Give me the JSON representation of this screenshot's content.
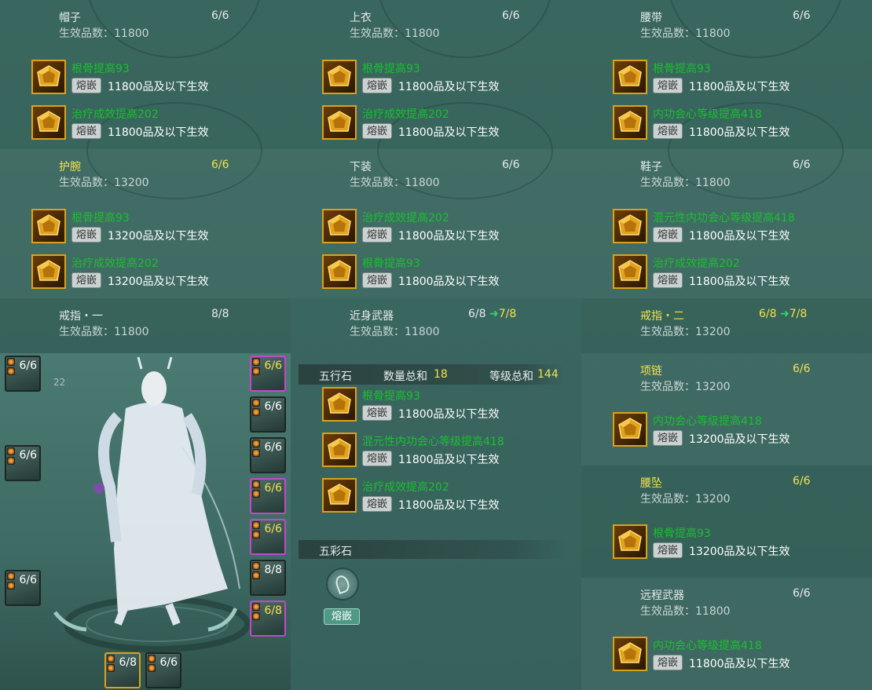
{
  "colors": {
    "gold": "#f2e24a",
    "green": "#19c02f",
    "arrow": "#39d46a",
    "pink_border": "#c548c8",
    "gold_border": "#d9a21b"
  },
  "slots": [
    {
      "title": "帽子",
      "count": "6/6",
      "grade_label": "生效品数：11800",
      "gems": [
        {
          "name": "根骨提高93",
          "button": "熔嵌",
          "desc": "11800品及以下生效"
        },
        {
          "name": "治疗成效提高202",
          "button": "熔嵌",
          "desc": "11800品及以下生效"
        }
      ]
    },
    {
      "title": "上衣",
      "count": "6/6",
      "grade_label": "生效品数：11800",
      "gems": [
        {
          "name": "根骨提高93",
          "button": "熔嵌",
          "desc": "11800品及以下生效"
        },
        {
          "name": "治疗成效提高202",
          "button": "熔嵌",
          "desc": "11800品及以下生效"
        }
      ]
    },
    {
      "title": "腰带",
      "count": "6/6",
      "grade_label": "生效品数：11800",
      "gems": [
        {
          "name": "根骨提高93",
          "button": "熔嵌",
          "desc": "11800品及以下生效"
        },
        {
          "name": "内功会心等级提高418",
          "button": "熔嵌",
          "desc": "11800品及以下生效"
        }
      ]
    },
    {
      "title": "护腕",
      "count": "6/6",
      "grade_label": "生效品数：13200",
      "gems": [
        {
          "name": "根骨提高93",
          "button": "熔嵌",
          "desc": "13200品及以下生效"
        },
        {
          "name": "治疗成效提高202",
          "button": "熔嵌",
          "desc": "13200品及以下生效"
        }
      ]
    },
    {
      "title": "下装",
      "count": "6/6",
      "grade_label": "生效品数：11800",
      "gems": [
        {
          "name": "治疗成效提高202",
          "button": "熔嵌",
          "desc": "11800品及以下生效"
        },
        {
          "name": "根骨提高93",
          "button": "熔嵌",
          "desc": "11800品及以下生效"
        }
      ]
    },
    {
      "title": "鞋子",
      "count": "6/6",
      "grade_label": "生效品数：11800",
      "gems": [
        {
          "name": "混元性内功会心等级提高418",
          "button": "熔嵌",
          "desc": "11800品及以下生效"
        },
        {
          "name": "治疗成效提高202",
          "button": "熔嵌",
          "desc": "11800品及以下生效"
        }
      ]
    },
    {
      "title": "戒指・一",
      "count": "8/8",
      "grade_label": "生效品数：11800",
      "gems": []
    },
    {
      "title": "近身武器",
      "count": "6/8",
      "count_next": "7/8",
      "grade_label": "生效品数：11800",
      "gems": [
        {
          "name": "根骨提高93",
          "button": "熔嵌",
          "desc": "11800品及以下生效"
        },
        {
          "name": "混元性内功会心等级提高418",
          "button": "熔嵌",
          "desc": "11800品及以下生效"
        },
        {
          "name": "治疗成效提高202",
          "button": "熔嵌",
          "desc": "11800品及以下生效"
        }
      ]
    },
    {
      "title": "戒指・二",
      "count": "6/8",
      "count_next": "7/8",
      "grade_label": "生效品数：13200",
      "gems": []
    },
    {
      "title": "项链",
      "count": "6/6",
      "grade_label": "生效品数：13200",
      "gems": [
        {
          "name": "内功会心等级提高418",
          "button": "熔嵌",
          "desc": "13200品及以下生效"
        }
      ]
    },
    {
      "title": "腰坠",
      "count": "6/6",
      "grade_label": "生效品数：13200",
      "gems": [
        {
          "name": "根骨提高93",
          "button": "熔嵌",
          "desc": "13200品及以下生效"
        }
      ]
    },
    {
      "title": "远程武器",
      "count": "6/6",
      "grade_label": "生效品数：11800",
      "gems": [
        {
          "name": "内功会心等级提高418",
          "button": "熔嵌",
          "desc": "11800品及以下生效"
        }
      ]
    }
  ],
  "wuxing": {
    "label": "五行石",
    "qty_label": "数量总和",
    "qty": "18",
    "level_label": "等级总和",
    "level": "144"
  },
  "wucai": {
    "label": "五彩石",
    "button": "熔嵌"
  },
  "side_slots_left": [
    {
      "count": "6/6"
    },
    {
      "count": "6/6"
    },
    {
      "count": "6/6"
    }
  ],
  "side_slots_right": [
    {
      "count": "6/6"
    },
    {
      "count": "6/6"
    },
    {
      "count": "6/6"
    },
    {
      "count": "6/6"
    },
    {
      "count": "6/6"
    },
    {
      "count": "8/8"
    },
    {
      "count": "6/8"
    }
  ],
  "bottom_slots": [
    {
      "count": "6/8"
    },
    {
      "count": "6/6"
    }
  ],
  "background_text": {
    "level": "22"
  }
}
